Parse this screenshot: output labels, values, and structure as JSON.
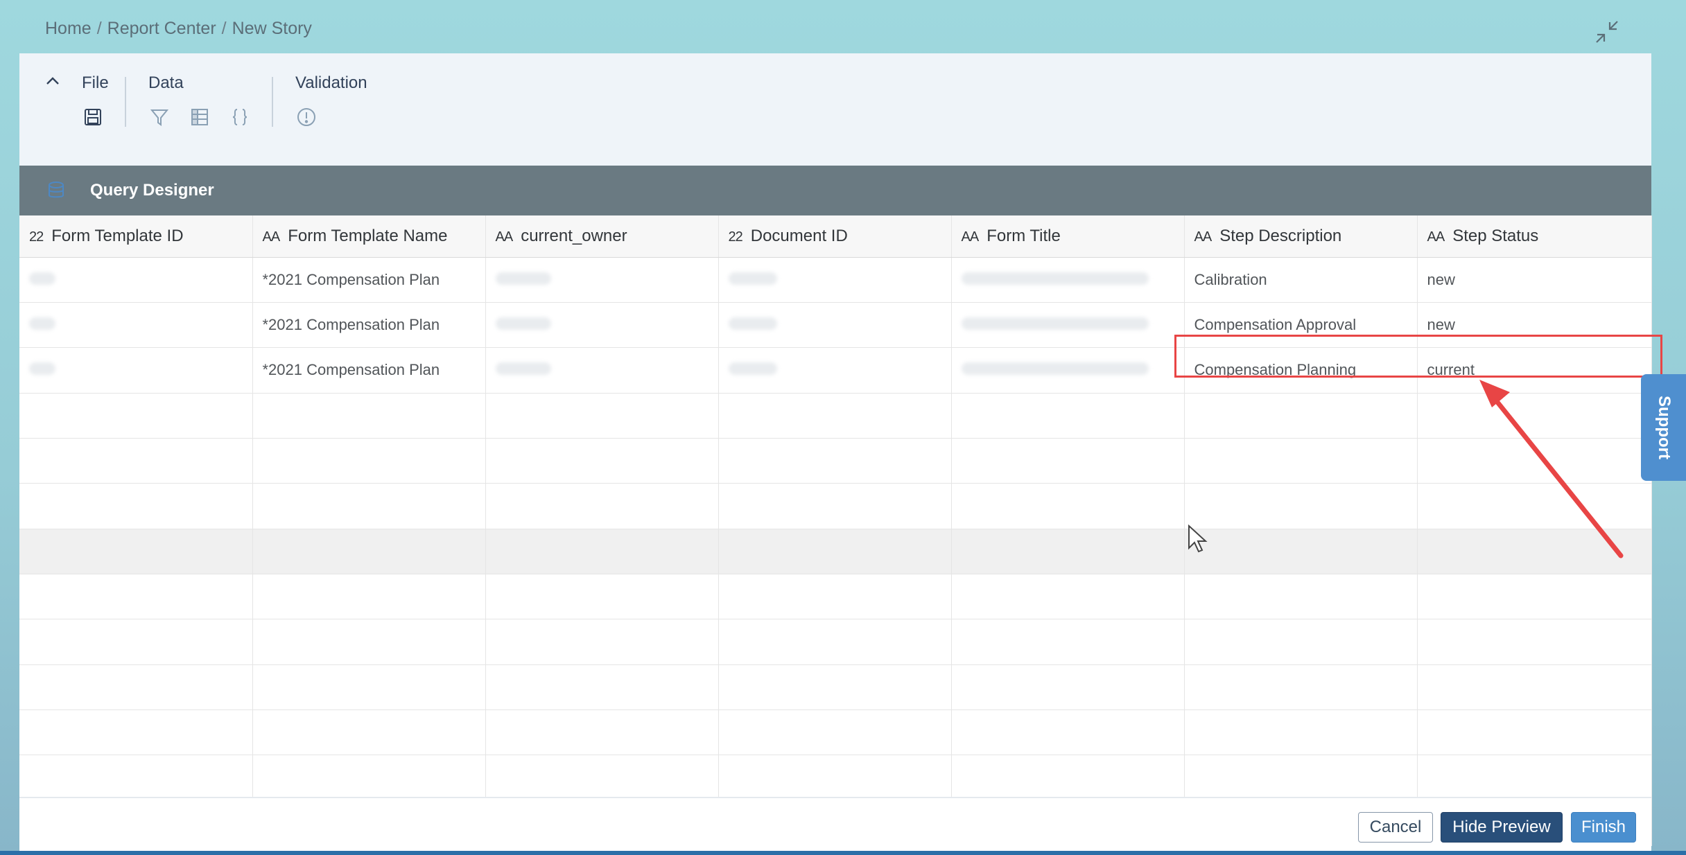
{
  "breadcrumb": {
    "home": "Home",
    "report_center": "Report Center",
    "current": "New Story",
    "separator": "/"
  },
  "toolbar": {
    "file_label": "File",
    "data_label": "Data",
    "validation_label": "Validation",
    "icons": {
      "collapse": "chevron-up-icon",
      "save": "save-icon",
      "filter": "filter-icon",
      "table": "table-icon",
      "formula": "curly-braces-icon",
      "validation": "exclamation-circle-icon"
    }
  },
  "query_designer": {
    "title": "Query Designer"
  },
  "grid": {
    "columns": [
      {
        "type": "22",
        "label": "Form Template ID"
      },
      {
        "type": "AA",
        "label": "Form Template Name"
      },
      {
        "type": "AA",
        "label": "current_owner"
      },
      {
        "type": "22",
        "label": "Document ID"
      },
      {
        "type": "AA",
        "label": "Form Title"
      },
      {
        "type": "AA",
        "label": "Step Description"
      },
      {
        "type": "AA",
        "label": "Step Status"
      }
    ],
    "rows": [
      [
        "",
        "*2021 Compensation Plan",
        "",
        "",
        "",
        "Calibration",
        "new"
      ],
      [
        "",
        "*2021 Compensation Plan",
        "",
        "",
        "",
        "Compensation Approval",
        "new"
      ],
      [
        "",
        "*2021 Compensation Plan",
        "",
        "",
        "",
        "Compensation Planning",
        "current"
      ]
    ]
  },
  "support_tab": "Support",
  "footer": {
    "cancel": "Cancel",
    "hide_preview": "Hide Preview",
    "finish": "Finish"
  },
  "colors": {
    "accent": "#4a8fcf",
    "emphasized": "#294f7a",
    "annotation": "#e84545",
    "header_bar": "#6a7a82"
  }
}
